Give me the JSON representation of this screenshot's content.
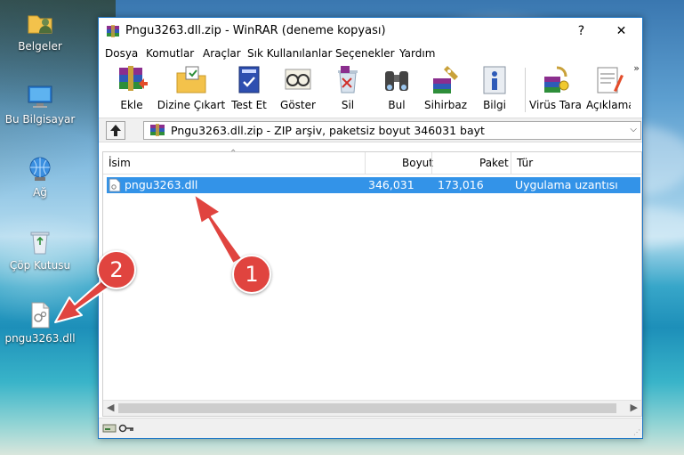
{
  "desktop": {
    "icons": [
      {
        "label": "Belgeler",
        "icon": "folder-user-icon"
      },
      {
        "label": "Bu Bilgisayar",
        "icon": "computer-icon"
      },
      {
        "label": "Ağ",
        "icon": "network-icon"
      },
      {
        "label": "Çöp Kutusu",
        "icon": "recycle-bin-icon"
      },
      {
        "label": "pngu3263.dll",
        "icon": "dll-file-icon"
      }
    ]
  },
  "window": {
    "title": "Pngu3263.dll.zip - WinRAR (deneme kopyası)",
    "help_btn": "?",
    "close_btn": "✕",
    "menu": [
      "Dosya",
      "Komutlar",
      "Araçlar",
      "Sık Kullanılanlar",
      "Seçenekler",
      "Yardım"
    ],
    "toolbar": [
      "Ekle",
      "Dizine Çıkart",
      "Test Et",
      "Göster",
      "Sil",
      "Bul",
      "Sihirbaz",
      "Bilgi",
      "Virüs Tara",
      "Açıklama"
    ],
    "more": "»",
    "address": "Pngu3263.dll.zip - ZIP arşiv, paketsiz boyut 346031 bayt",
    "columns": {
      "name": "İsim",
      "size": "Boyut",
      "packed": "Paket",
      "type": "Tür"
    },
    "files": [
      {
        "name": "pngu3263.dll",
        "size": "346,031",
        "packed": "173,016",
        "type": "Uygulama uzantısı"
      }
    ]
  },
  "annotations": {
    "badge1": "1",
    "badge2": "2"
  },
  "colors": {
    "selection": "#3393e8",
    "badge": "#e0443f",
    "window_border": "#1e76c5"
  }
}
